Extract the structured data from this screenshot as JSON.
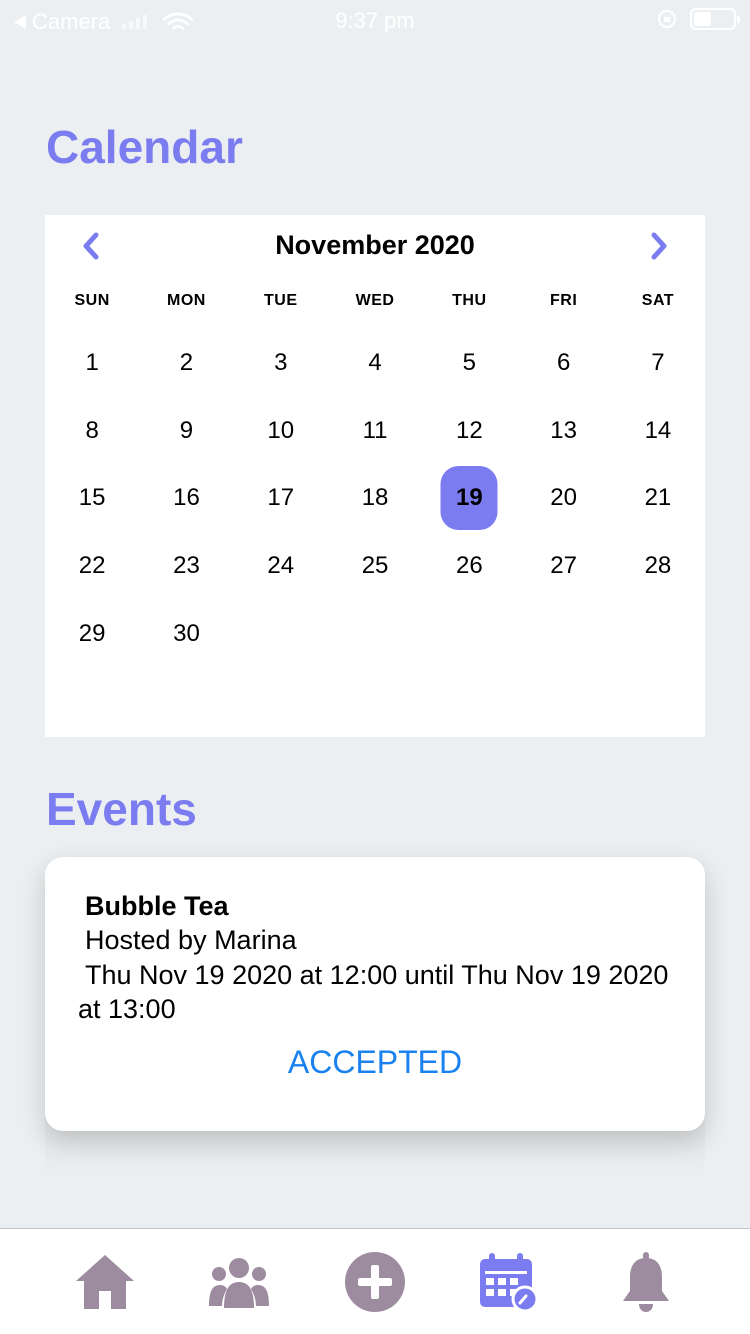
{
  "status_bar": {
    "back_app": "Camera",
    "time": "9:37 pm",
    "battery_level": 0.45
  },
  "calendar": {
    "title": "Calendar",
    "month_label": "November 2020",
    "weekdays": [
      "SUN",
      "MON",
      "TUE",
      "WED",
      "THU",
      "FRI",
      "SAT"
    ],
    "days": [
      "1",
      "2",
      "3",
      "4",
      "5",
      "6",
      "7",
      "8",
      "9",
      "10",
      "11",
      "12",
      "13",
      "14",
      "15",
      "16",
      "17",
      "18",
      "19",
      "20",
      "21",
      "22",
      "23",
      "24",
      "25",
      "26",
      "27",
      "28",
      "29",
      "30"
    ],
    "first_weekday_index": 0,
    "selected_day": "19",
    "accent_color": "#7b7cf0"
  },
  "events": {
    "title": "Events",
    "items": [
      {
        "name": "Bubble Tea",
        "host": "Hosted by Marina",
        "time": "Thu Nov 19 2020 at 12:00 until Thu Nov 19 2020 at 13:00",
        "status": "ACCEPTED"
      }
    ]
  },
  "tab_bar": {
    "icon_color": "#9d8c9f",
    "active_color": "#7b7cf0",
    "tabs": [
      {
        "name": "home-icon"
      },
      {
        "name": "groups-icon"
      },
      {
        "name": "add-icon"
      },
      {
        "name": "calendar-icon",
        "active": true
      },
      {
        "name": "bell-icon"
      }
    ]
  }
}
